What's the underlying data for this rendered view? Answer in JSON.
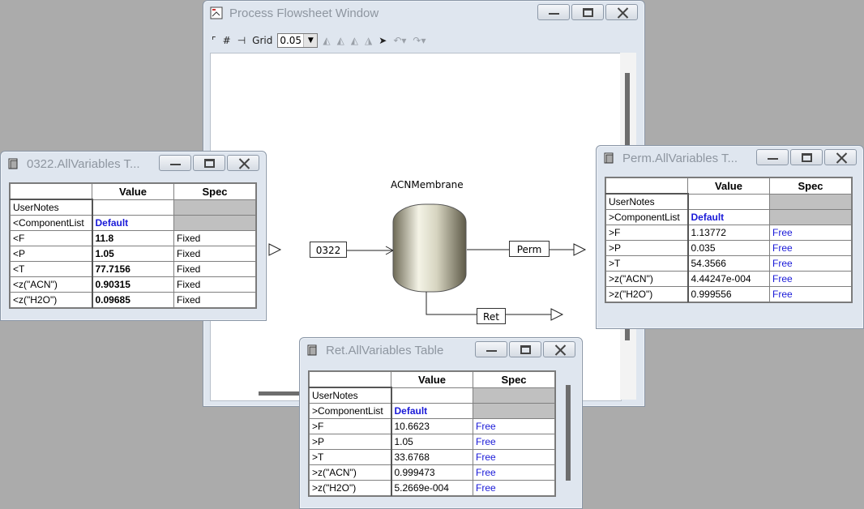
{
  "flowsheet": {
    "title": "Process Flowsheet Window",
    "toolbar": {
      "grid_label": "Grid",
      "grid_value": "0.05"
    },
    "unit_name": "ACNMembrane",
    "streams": {
      "feed": "0322",
      "perm": "Perm",
      "ret": "Ret"
    }
  },
  "tables": {
    "t0322": {
      "title": "0322.AllVariables T...",
      "headers": [
        "Value",
        "Spec"
      ],
      "rows": [
        {
          "name": "UserNotes",
          "value": "",
          "spec": ""
        },
        {
          "name": "<ComponentList",
          "value": "Default",
          "spec": ""
        },
        {
          "name": "<F",
          "value": "11.8",
          "spec": "Fixed"
        },
        {
          "name": "<P",
          "value": "1.05",
          "spec": "Fixed"
        },
        {
          "name": "<T",
          "value": "77.7156",
          "spec": "Fixed"
        },
        {
          "name": "<z(\"ACN\")",
          "value": "0.90315",
          "spec": "Fixed"
        },
        {
          "name": "<z(\"H2O\")",
          "value": "0.09685",
          "spec": "Fixed"
        }
      ]
    },
    "perm": {
      "title": "Perm.AllVariables T...",
      "headers": [
        "Value",
        "Spec"
      ],
      "rows": [
        {
          "name": "UserNotes",
          "value": "",
          "spec": ""
        },
        {
          "name": ">ComponentList",
          "value": "Default",
          "spec": ""
        },
        {
          "name": ">F",
          "value": "1.13772",
          "spec": "Free"
        },
        {
          "name": ">P",
          "value": "0.035",
          "spec": "Free"
        },
        {
          "name": ">T",
          "value": "54.3566",
          "spec": "Free"
        },
        {
          "name": ">z(\"ACN\")",
          "value": "4.44247e-004",
          "spec": "Free"
        },
        {
          "name": ">z(\"H2O\")",
          "value": "0.999556",
          "spec": "Free"
        }
      ]
    },
    "ret": {
      "title": "Ret.AllVariables Table",
      "headers": [
        "Value",
        "Spec"
      ],
      "rows": [
        {
          "name": "UserNotes",
          "value": "",
          "spec": ""
        },
        {
          "name": ">ComponentList",
          "value": "Default",
          "spec": ""
        },
        {
          "name": ">F",
          "value": "10.6623",
          "spec": "Free"
        },
        {
          "name": ">P",
          "value": "1.05",
          "spec": "Free"
        },
        {
          "name": ">T",
          "value": "33.6768",
          "spec": "Free"
        },
        {
          "name": ">z(\"ACN\")",
          "value": "0.999473",
          "spec": "Free"
        },
        {
          "name": ">z(\"H2O\")",
          "value": "5.2669e-004",
          "spec": "Free"
        }
      ]
    }
  }
}
